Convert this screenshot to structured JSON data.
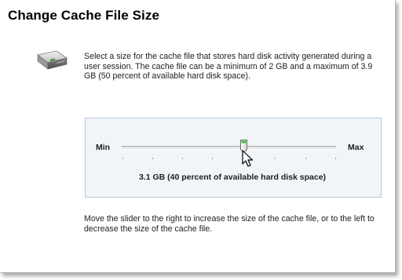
{
  "dialog": {
    "title": "Change Cache File Size",
    "description": "Select a size for the cache file that stores hard disk activity generated during a user session. The cache file can be a minimum of 2 GB and a maximum of 3.9 GB (50 percent of available hard disk space).",
    "icon": "hard-disk-icon"
  },
  "slider": {
    "min_label": "Min",
    "max_label": "Max",
    "position": 0.57,
    "value_text": "3.1 GB (40 percent of available hard disk space)"
  },
  "help_text": "Move the slider to the right to increase the size of the cache file, or to the left to decrease the size of the cache file.",
  "colors": {
    "panel_bg": "#f1f4f8",
    "panel_border": "#b9c9db",
    "thumb_accent": "#3fbf3f"
  }
}
